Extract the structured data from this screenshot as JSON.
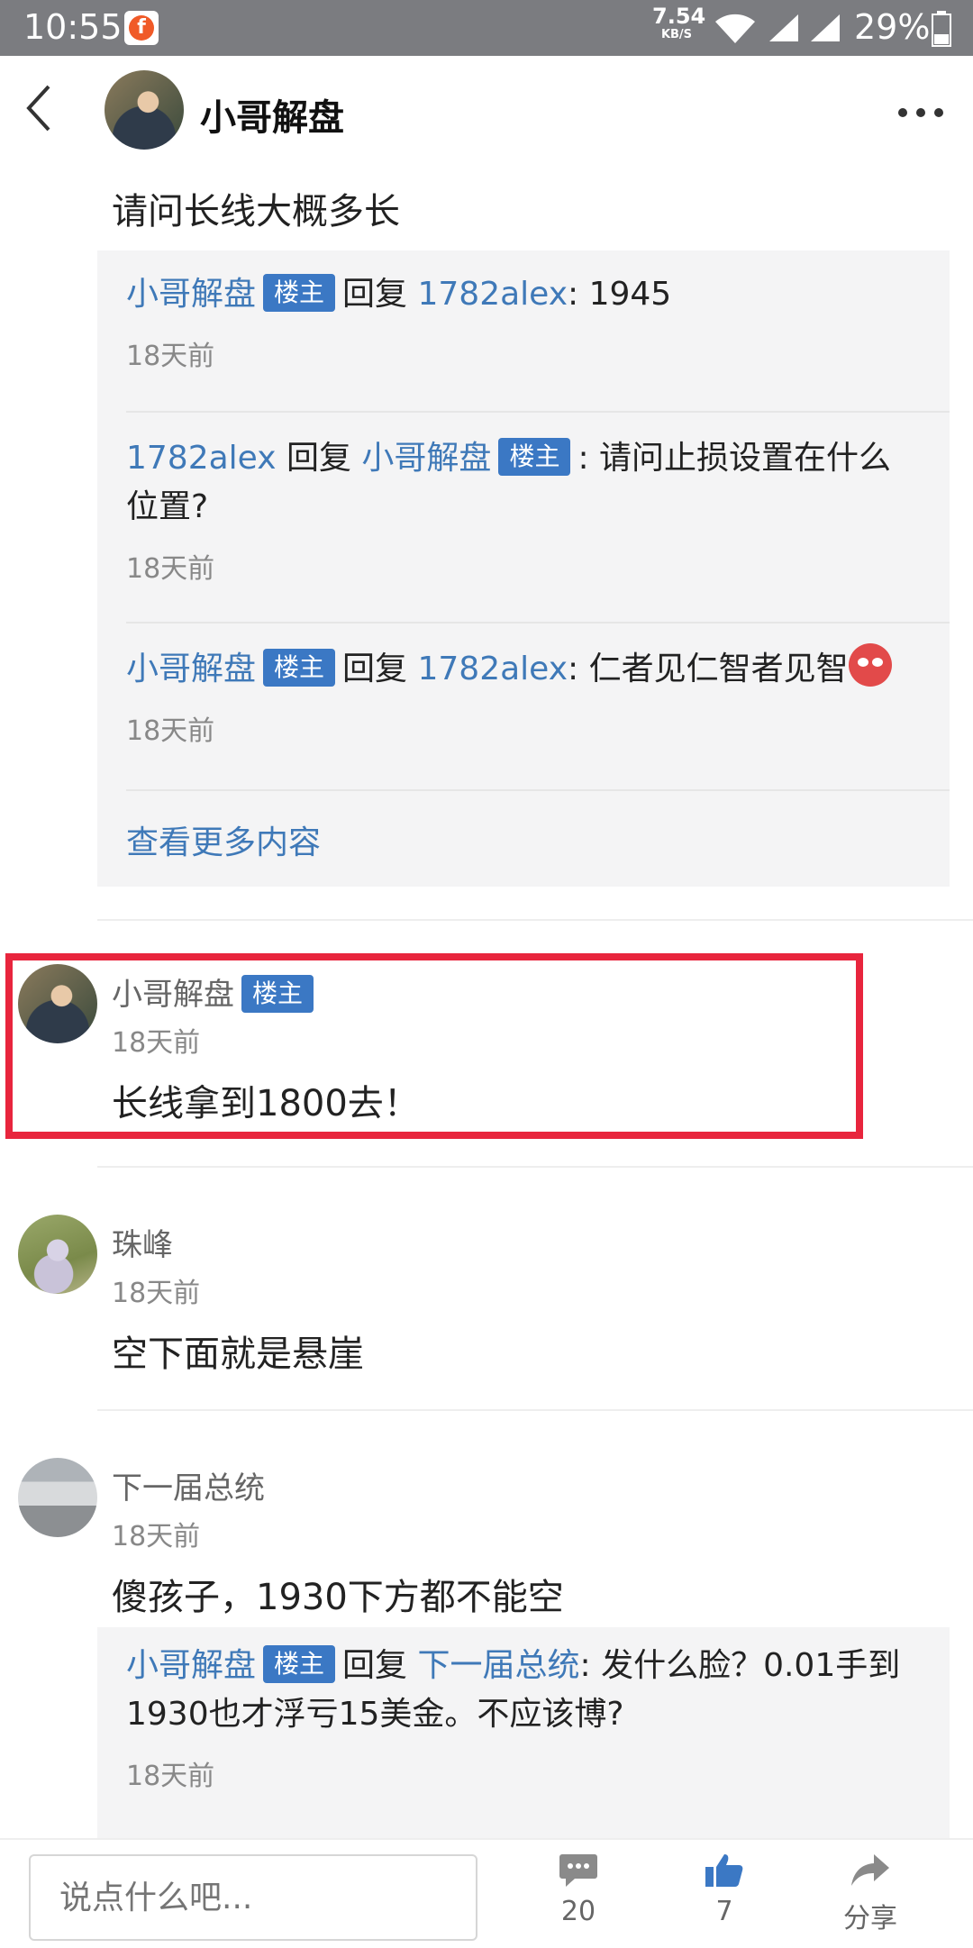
{
  "status_bar": {
    "time": "10:55",
    "net_speed_value": "7.54",
    "net_speed_unit": "KB/S",
    "battery": "29%"
  },
  "header": {
    "title": "小哥解盘"
  },
  "question": "请问长线大概多长",
  "reply_thread": {
    "items": [
      {
        "author": "小哥解盘",
        "badge": "楼主",
        "reply_word": "回复",
        "target": "1782alex",
        "text": ": 1945",
        "time": "18天前"
      },
      {
        "author": "1782alex",
        "reply_word": "回复",
        "target": "小哥解盘",
        "badge": "楼主",
        "text": ": 请问止损设置在什么位置?",
        "time": "18天前"
      },
      {
        "author": "小哥解盘",
        "badge": "楼主",
        "reply_word": "回复",
        "target": "1782alex",
        "text": ": 仁者见仁智者见智",
        "time": "18天前"
      }
    ],
    "see_more": "查看更多内容"
  },
  "comments": [
    {
      "name": "小哥解盘",
      "badge": "楼主",
      "time": "18天前",
      "text": "长线拿到1800去！"
    },
    {
      "name": "珠峰",
      "time": "18天前",
      "text": "空下面就是悬崖"
    },
    {
      "name": "下一届总统",
      "time": "18天前",
      "text": "傻孩子，1930下方都不能空"
    }
  ],
  "nested_reply": {
    "author": "小哥解盘",
    "badge": "楼主",
    "reply_word": "回复",
    "target": "下一届总统",
    "text": ": 发什么脸？0.01手到1930也才浮亏15美金。不应该博?",
    "time": "18天前"
  },
  "bottom_bar": {
    "input_placeholder": "说点什么吧...",
    "comment_count": "20",
    "like_count": "7",
    "share_label": "分享"
  },
  "colors": {
    "accent_blue": "#3f79b8",
    "badge_blue": "#3b78c4",
    "highlight_red": "#e8253d",
    "status_bar_gray": "#7b7c80"
  }
}
